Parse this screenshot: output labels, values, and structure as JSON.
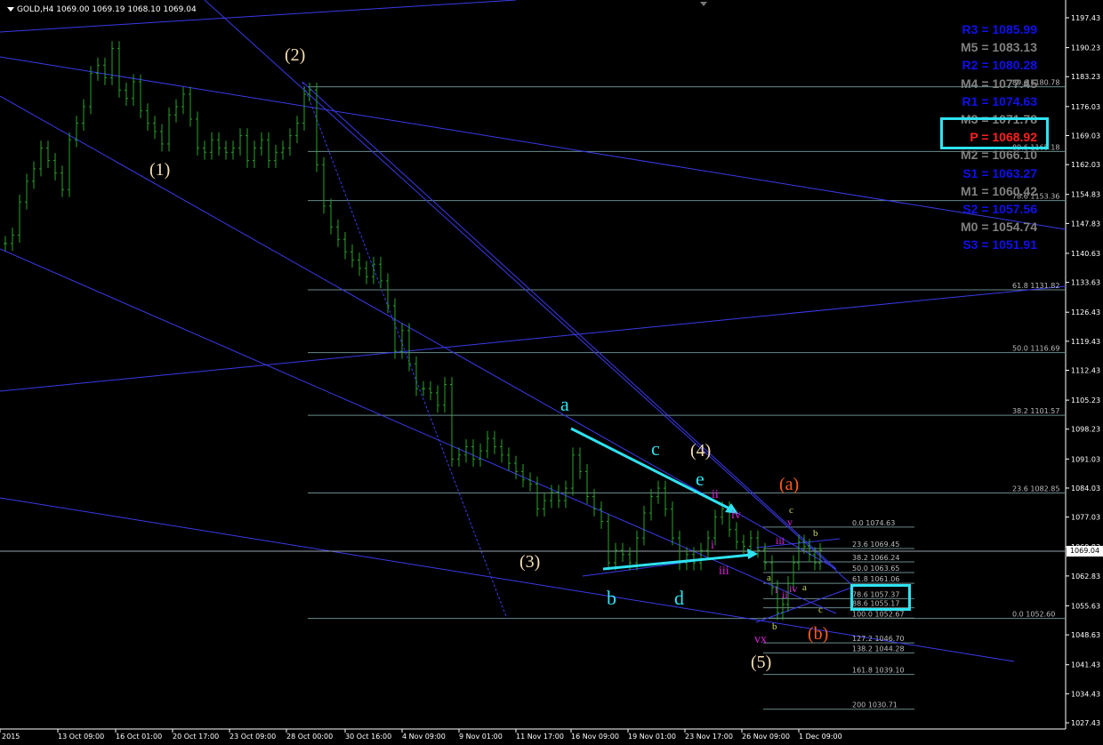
{
  "header": {
    "symbol": "GOLD,H4",
    "ohlc": "1069.00 1069.19 1068.10 1069.04"
  },
  "current_price": "1069.04",
  "y_axis": [
    "1197.43",
    "1190.23",
    "1183.23",
    "1176.03",
    "1169.03",
    "1162.03",
    "1154.83",
    "1147.83",
    "1140.63",
    "1133.63",
    "1126.43",
    "1119.43",
    "1112.43",
    "1105.23",
    "1098.23",
    "1091.03",
    "1084.03",
    "1077.03",
    "1069.83",
    "1062.83",
    "1055.63",
    "1048.63",
    "1041.43",
    "1034.43",
    "1027.43"
  ],
  "x_axis": [
    "8 Oct 2015",
    "13 Oct 09:00",
    "16 Oct 01:00",
    "20 Oct 17:00",
    "23 Oct 09:00",
    "28 Oct 00:00",
    "30 Oct 16:00",
    "4 Nov 09:00",
    "9 Nov 01:00",
    "11 Nov 17:00",
    "16 Nov 09:00",
    "19 Nov 01:00",
    "23 Nov 17:00",
    "26 Nov 09:00",
    "1 Dec 09:00"
  ],
  "pivots": [
    {
      "label": "R3 = 1085.99",
      "color": "#1010ee"
    },
    {
      "label": "M5 = 1083.13",
      "color": "#808080"
    },
    {
      "label": "R2 = 1080.28",
      "color": "#1010ee"
    },
    {
      "label": "M4 = 1077.45",
      "color": "#808080"
    },
    {
      "label": "R1 = 1074.63",
      "color": "#1010ee"
    },
    {
      "label": "M3 = 1071.78",
      "color": "#808080"
    },
    {
      "label": "P  = 1068.92",
      "color": "#ff2020"
    },
    {
      "label": "M2 = 1066.10",
      "color": "#808080"
    },
    {
      "label": "S1 = 1063.27",
      "color": "#1010ee"
    },
    {
      "label": "M1 = 1060.42",
      "color": "#808080"
    },
    {
      "label": "S2 = 1057.56",
      "color": "#1010ee"
    },
    {
      "label": "M0 = 1054.74",
      "color": "#808080"
    },
    {
      "label": "S3 = 1051.91",
      "color": "#1010ee"
    }
  ],
  "fib_big": [
    {
      "label": "89.6  1180.78",
      "y": 1180.78
    },
    {
      "label": "89.6  1165.18",
      "y": 1165.18
    },
    {
      "label": "78.6  1153.36",
      "y": 1153.36
    },
    {
      "label": "61.8  1131.82",
      "y": 1131.82
    },
    {
      "label": "50.0  1116.69",
      "y": 1116.69
    },
    {
      "label": "38.2  1101.57",
      "y": 1101.57
    },
    {
      "label": "23.6  1082.85",
      "y": 1082.85
    },
    {
      "label": "0.0  1052.60",
      "y": 1052.6
    }
  ],
  "fib_small": [
    {
      "label": "0.0  1074.63",
      "y": 1074.63
    },
    {
      "label": "23.6  1069.45",
      "y": 1069.45
    },
    {
      "label": "38.2  1066.24",
      "y": 1066.24
    },
    {
      "label": "50.0  1063.65",
      "y": 1063.65
    },
    {
      "label": "61.8  1061.06",
      "y": 1061.06
    },
    {
      "label": "78.6  1057.37",
      "y": 1057.37
    },
    {
      "label": "88.6  1055.17",
      "y": 1055.17
    },
    {
      "label": "100.0  1052.67",
      "y": 1052.67
    },
    {
      "label": "127.2  1046.70",
      "y": 1046.7
    },
    {
      "label": "138.2  1044.28",
      "y": 1044.28
    },
    {
      "label": "161.8  1039.10",
      "y": 1039.1
    },
    {
      "label": "200  1030.71",
      "y": 1030.71
    }
  ],
  "waves": [
    {
      "t": "(1)",
      "c": "#f5deb3"
    },
    {
      "t": "(2)",
      "c": "#f5deb3"
    },
    {
      "t": "(3)",
      "c": "#f5deb3"
    },
    {
      "t": "(4)",
      "c": "#f5deb3"
    },
    {
      "t": "(5)",
      "c": "#f5deb3"
    },
    {
      "t": "a",
      "c": "#2fe3f1"
    },
    {
      "t": "b",
      "c": "#2fe3f1"
    },
    {
      "t": "c",
      "c": "#2fe3f1"
    },
    {
      "t": "d",
      "c": "#2fe3f1"
    },
    {
      "t": "e",
      "c": "#2fe3f1"
    },
    {
      "t": "(a)",
      "c": "#ff5a1a"
    },
    {
      "t": "(b)",
      "c": "#ff5a1a"
    },
    {
      "t": "ii",
      "c": "#e020e0"
    },
    {
      "t": "iv",
      "c": "#e020e0"
    },
    {
      "t": "i",
      "c": "#e020e0"
    },
    {
      "t": "iii",
      "c": "#e020e0"
    },
    {
      "t": "vx",
      "c": "#e020e0"
    },
    {
      "t": "v",
      "c": "#e020e0"
    },
    {
      "t": "iii",
      "c": "#e020e0"
    },
    {
      "t": "i",
      "c": "#e020e0"
    },
    {
      "t": "iv",
      "c": "#e020e0"
    },
    {
      "t": "ii",
      "c": "#e020e0"
    },
    {
      "t": "c",
      "c": "#c8d860"
    },
    {
      "t": "b",
      "c": "#c8d860"
    },
    {
      "t": "a",
      "c": "#c8d860"
    },
    {
      "t": "a",
      "c": "#c8d860"
    },
    {
      "t": "c",
      "c": "#c8d860"
    },
    {
      "t": "b",
      "c": "#c8d860"
    }
  ]
}
